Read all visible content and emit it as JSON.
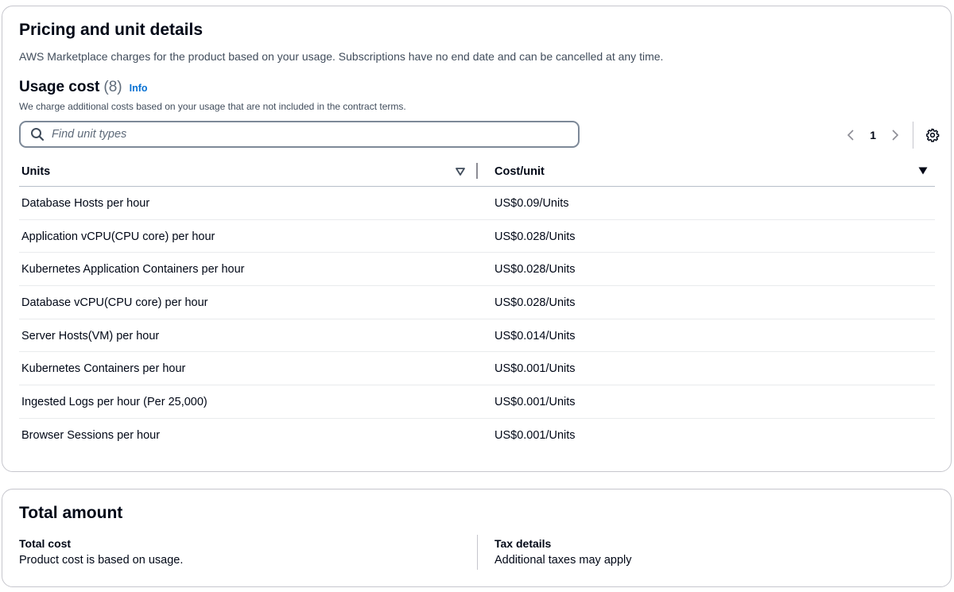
{
  "pricing": {
    "title": "Pricing and unit details",
    "description": "AWS Marketplace charges for the product based on your usage. Subscriptions have no end date and can be cancelled at any time."
  },
  "usage": {
    "title": "Usage cost",
    "count": "(8)",
    "info_label": "Info",
    "description": "We charge additional costs based on your usage that are not included in the contract terms.",
    "search_placeholder": "Find unit types",
    "search_value": "",
    "current_page": "1"
  },
  "table": {
    "headers": {
      "units": "Units",
      "cost": "Cost/unit"
    },
    "rows": [
      {
        "unit": "Database Hosts per hour",
        "cost": "US$0.09/Units"
      },
      {
        "unit": "Application vCPU(CPU core) per hour",
        "cost": "US$0.028/Units"
      },
      {
        "unit": "Kubernetes Application Containers per hour",
        "cost": "US$0.028/Units"
      },
      {
        "unit": "Database vCPU(CPU core) per hour",
        "cost": "US$0.028/Units"
      },
      {
        "unit": "Server Hosts(VM) per hour",
        "cost": "US$0.014/Units"
      },
      {
        "unit": "Kubernetes Containers per hour",
        "cost": "US$0.001/Units"
      },
      {
        "unit": "Ingested Logs per hour (Per 25,000)",
        "cost": "US$0.001/Units"
      },
      {
        "unit": "Browser Sessions per hour",
        "cost": "US$0.001/Units"
      }
    ]
  },
  "total": {
    "title": "Total amount",
    "cost_label": "Total cost",
    "cost_value": "Product cost is based on usage.",
    "tax_label": "Tax details",
    "tax_value": "Additional taxes may apply"
  },
  "colors": {
    "accent_link": "#0972d3",
    "text_primary": "#000716",
    "text_secondary": "#414d5c",
    "border": "#c6c6cd"
  },
  "icons": {
    "search": "search-icon",
    "prev": "chevron-left-icon",
    "next": "chevron-right-icon",
    "settings": "gear-icon",
    "sort_units": "sort-triangle-outline-icon",
    "sort_cost": "sort-triangle-filled-icon"
  }
}
